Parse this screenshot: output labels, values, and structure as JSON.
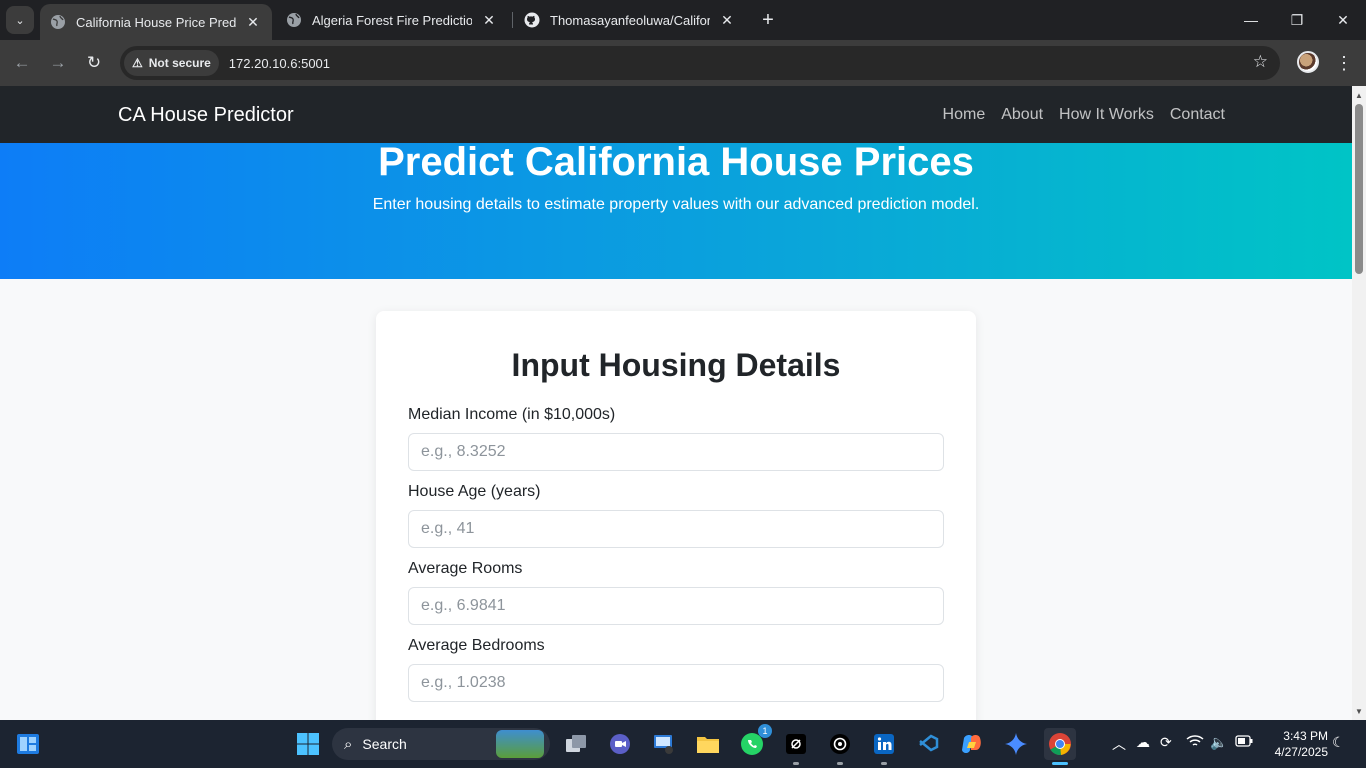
{
  "browser": {
    "tabs": [
      {
        "title": "California House Price Prediction",
        "active": true
      },
      {
        "title": "Algeria Forest Fire Prediction",
        "active": false
      },
      {
        "title": "Thomasayanfeoluwa/California",
        "active": false
      }
    ],
    "security_label": "Not secure",
    "url": "172.20.10.6:5001"
  },
  "site": {
    "brand": "CA House Predictor",
    "nav": [
      "Home",
      "About",
      "How It Works",
      "Contact"
    ],
    "hero_title": "Predict California House Prices",
    "hero_subtitle": "Enter housing details to estimate property values with our advanced prediction model.",
    "form_title": "Input Housing Details",
    "fields": [
      {
        "label": "Median Income (in $10,000s)",
        "placeholder": "e.g., 8.3252"
      },
      {
        "label": "House Age (years)",
        "placeholder": "e.g., 41"
      },
      {
        "label": "Average Rooms",
        "placeholder": "e.g., 6.9841"
      },
      {
        "label": "Average Bedrooms",
        "placeholder": "e.g., 1.0238"
      }
    ]
  },
  "taskbar": {
    "search_label": "Search",
    "whatsapp_badge": "1",
    "time": "3:43 PM",
    "date": "4/27/2025"
  },
  "colors": {
    "navbar": "#212529",
    "hero_gradient_start": "#0d7df7",
    "hero_gradient_end": "#00c4c6"
  }
}
